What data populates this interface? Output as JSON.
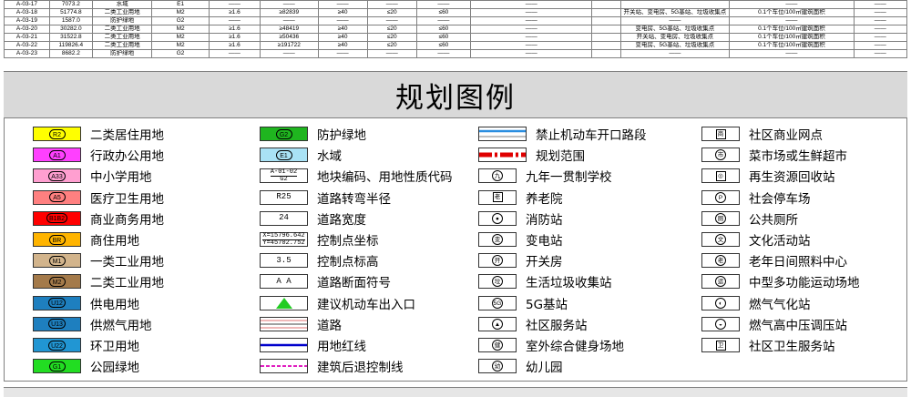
{
  "table": {
    "rows": [
      [
        "A-03-17",
        "7073.2",
        "水域",
        "E1",
        "——",
        "——",
        "——",
        "——",
        "——",
        "——",
        "",
        "",
        "——",
        "——"
      ],
      [
        "A-03-18",
        "51774.8",
        "二类工业用地",
        "M2",
        "≥1.6",
        "≥82839",
        "≥40",
        "≤20",
        "≤60",
        "——",
        "",
        "开关站、变电房、5G基站、垃圾收集点",
        "0.1个车位/100㎡建筑面积",
        "——"
      ],
      [
        "A-03-19",
        "1587.0",
        "防护绿地",
        "G2",
        "——",
        "——",
        "——",
        "——",
        "——",
        "——",
        "",
        "——",
        "——",
        "——"
      ],
      [
        "A-03-20",
        "30282.0",
        "二类工业用地",
        "M2",
        "≥1.6",
        "≥48419",
        "≥40",
        "≤20",
        "≤60",
        "——",
        "",
        "变电房、5G基站、垃圾收集点",
        "0.1个车位/100㎡建筑面积",
        "——"
      ],
      [
        "A-03-21",
        "31522.8",
        "二类工业用地",
        "M2",
        "≥1.6",
        "≥50436",
        "≥40",
        "≤20",
        "≤60",
        "——",
        "",
        "开关站、变电房、垃圾收集点",
        "0.1个车位/100㎡建筑面积",
        "——"
      ],
      [
        "A-03-22",
        "119826.4",
        "二类工业用地",
        "M2",
        "≥1.6",
        "≥191722",
        "≥40",
        "≤20",
        "≤60",
        "——",
        "",
        "变电房、5G基站、垃圾收集点",
        "0.1个车位/100㎡建筑面积",
        "——"
      ],
      [
        "A-03-23",
        "8682.2",
        "防护绿地",
        "G2",
        "——",
        "——",
        "——",
        "——",
        "——",
        "——",
        "",
        "——",
        "——",
        "——"
      ]
    ]
  },
  "title": "规划图例",
  "legend": {
    "col1": [
      {
        "code": "R2",
        "label": "二类居住用地",
        "color": "#ffff00"
      },
      {
        "code": "A1",
        "label": "行政办公用地",
        "color": "#ff40ff"
      },
      {
        "code": "A33",
        "label": "中小学用地",
        "color": "#ff9fd0"
      },
      {
        "code": "A5",
        "label": "医疗卫生用地",
        "color": "#ff8080"
      },
      {
        "code": "B1B2",
        "label": "商业商务用地",
        "color": "#ff0000"
      },
      {
        "code": "BR",
        "label": "商住用地",
        "color": "#ffb400"
      },
      {
        "code": "M1",
        "label": "一类工业用地",
        "color": "#d2b48c"
      },
      {
        "code": "M2",
        "label": "二类工业用地",
        "color": "#a47a4a"
      },
      {
        "code": "U12",
        "label": "供电用地",
        "color": "#1e7fbf"
      },
      {
        "code": "U13",
        "label": "供燃气用地",
        "color": "#1e7fbf"
      },
      {
        "code": "U22",
        "label": "环卫用地",
        "color": "#2196d3"
      },
      {
        "code": "G1",
        "label": "公园绿地",
        "color": "#22dd22"
      }
    ],
    "col2": [
      {
        "kind": "swatch",
        "code": "G2",
        "label": "防护绿地",
        "color": "#1fb51f"
      },
      {
        "kind": "swatch",
        "code": "E1",
        "label": "水域",
        "color": "#a9e2f5"
      },
      {
        "kind": "text",
        "sym": "A-01-02 / G2",
        "sym_top": "A-01-02",
        "sym_bottom": "G2",
        "label": "地块编码、用地性质代码"
      },
      {
        "kind": "text",
        "sym": "R25",
        "label": "道路转弯半径"
      },
      {
        "kind": "text",
        "sym": "24",
        "label": "道路宽度"
      },
      {
        "kind": "text",
        "sym": "X=15796.642 / Y=45702.752",
        "sym_top": "X=15796.642",
        "sym_bottom": "Y=45702.752",
        "label": "控制点坐标"
      },
      {
        "kind": "text",
        "sym": "3.5",
        "label": "控制点标高"
      },
      {
        "kind": "text",
        "sym": "A A",
        "label": "道路断面符号"
      },
      {
        "kind": "triangle",
        "label": "建议机动车出入口",
        "color": "#22cc22"
      },
      {
        "kind": "road",
        "label": "道路",
        "color": "#e07070"
      },
      {
        "kind": "redline",
        "label": "用地红线",
        "color": "#0000cc"
      },
      {
        "kind": "setback",
        "label": "建筑后退控制线",
        "color": "#e020c0"
      }
    ],
    "col3": [
      {
        "kind": "noentry",
        "label": "禁止机动车开口路段",
        "color": "#2a8ee0"
      },
      {
        "kind": "boundary",
        "label": "规划范围",
        "color": "#e00000"
      },
      {
        "kind": "circle",
        "glyph": "九",
        "label": "九年一贯制学校"
      },
      {
        "kind": "square",
        "glyph": "老",
        "label": "养老院"
      },
      {
        "kind": "circle",
        "glyph": "●",
        "label": "消防站"
      },
      {
        "kind": "circle",
        "glyph": "变",
        "label": "变电站"
      },
      {
        "kind": "circle",
        "glyph": "开",
        "label": "开关房"
      },
      {
        "kind": "circle",
        "glyph": "垃",
        "label": "生活垃圾收集站"
      },
      {
        "kind": "circle",
        "glyph": "5G",
        "label": "5G基站"
      },
      {
        "kind": "circle",
        "glyph": "▲",
        "label": "社区服务站"
      },
      {
        "kind": "circle",
        "glyph": "健",
        "label": "室外综合健身场地"
      },
      {
        "kind": "circle",
        "glyph": "幼",
        "label": "幼儿园"
      }
    ],
    "col4": [
      {
        "kind": "square",
        "glyph": "商",
        "label": "社区商业网点"
      },
      {
        "kind": "circle",
        "glyph": "市",
        "label": "菜市场或生鲜超市"
      },
      {
        "kind": "square",
        "glyph": "◎",
        "label": "再生资源回收站"
      },
      {
        "kind": "circle",
        "glyph": "P",
        "label": "社会停车场"
      },
      {
        "kind": "circle",
        "glyph": "厕",
        "label": "公共厕所"
      },
      {
        "kind": "circle",
        "glyph": "文",
        "label": "文化活动站"
      },
      {
        "kind": "circle",
        "glyph": "老",
        "label": "老年日间照料中心"
      },
      {
        "kind": "circle",
        "glyph": "运",
        "label": "中型多功能运动场地"
      },
      {
        "kind": "circle",
        "glyph": "◐",
        "label": "燃气气化站"
      },
      {
        "kind": "circle",
        "glyph": "◒",
        "label": "燃气高中压调压站"
      },
      {
        "kind": "square",
        "glyph": "卫",
        "label": "社区卫生服务站"
      }
    ]
  }
}
